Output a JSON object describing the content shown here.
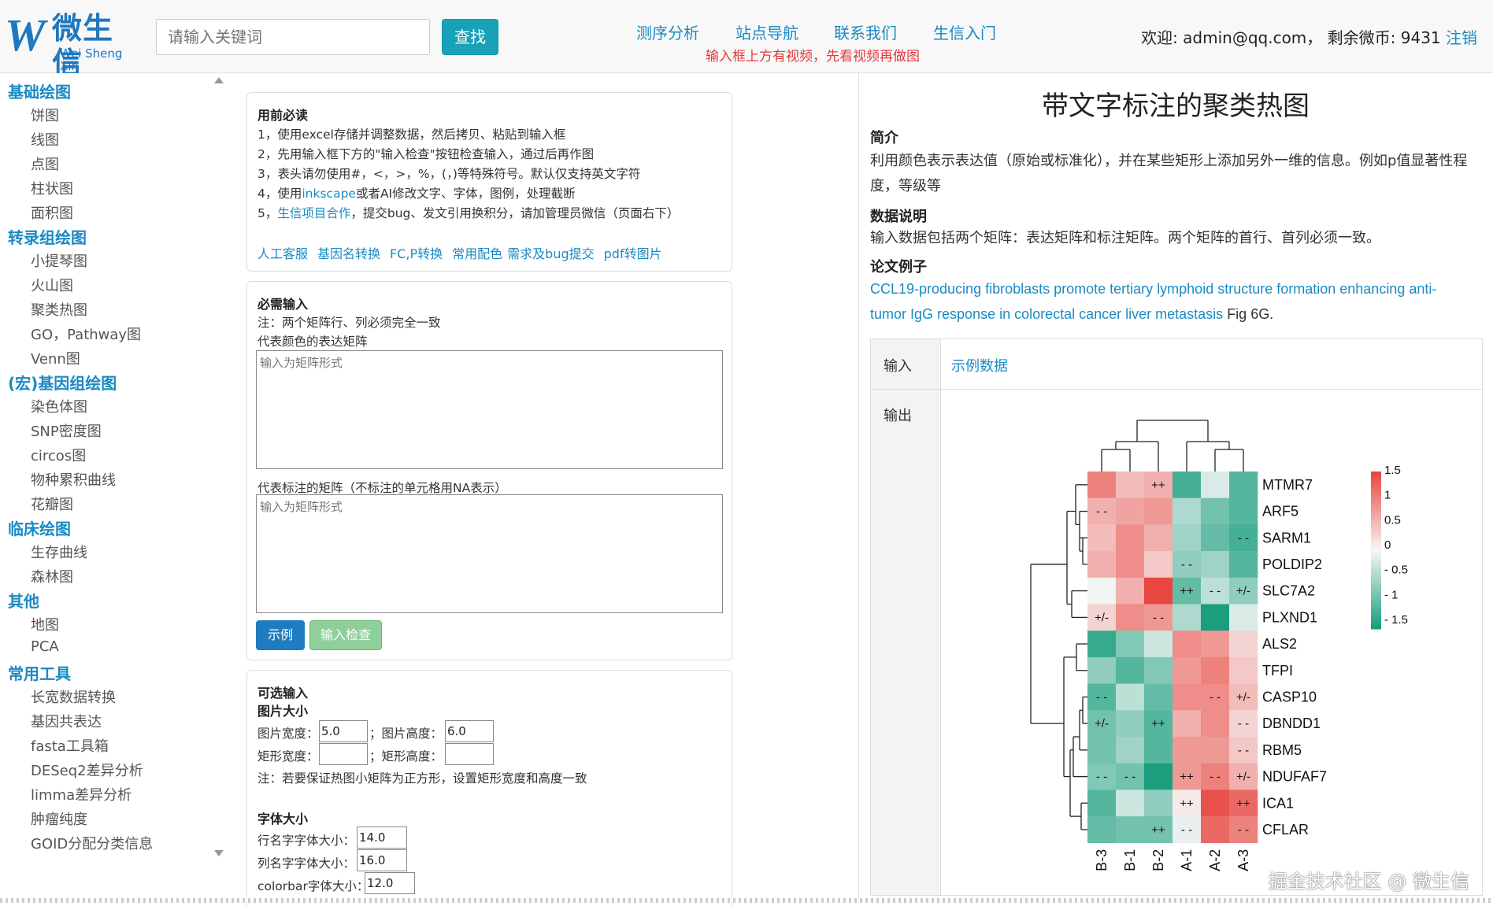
{
  "header": {
    "logo_cn": "微生信",
    "logo_py": "Wei Sheng Xin",
    "search_placeholder": "请输入关键词",
    "search_button": "查找",
    "nav": [
      "测序分析",
      "站点导航",
      "联系我们",
      "生信入门"
    ],
    "notice": "输入框上方有视频，先看视频再做图",
    "welcome": "欢迎: admin@qq.com， 剩余微币: 9431",
    "logout": "注销"
  },
  "sidebar": {
    "cat1": "基础绘图",
    "items1": [
      "饼图",
      "线图",
      "点图",
      "柱状图",
      "面积图"
    ],
    "cat2": "转录组绘图",
    "items2": [
      "小提琴图",
      "火山图",
      "聚类热图",
      "GO，Pathway图",
      "Venn图"
    ],
    "cat3": "(宏)基因组绘图",
    "items3": [
      "染色体图",
      "SNP密度图",
      "circos图",
      "物种累积曲线",
      "花瓣图"
    ],
    "cat4": "临床绘图",
    "items4": [
      "生存曲线",
      "森林图"
    ],
    "cat5": "其他",
    "items5": [
      "地图",
      "PCA"
    ],
    "cat6": "常用工具",
    "items6": [
      "长宽数据转换",
      "基因共表达",
      "fasta工具箱",
      "DESeq2差异分析",
      "limma差异分析",
      "肿瘤纯度",
      "GOID分配分类信息"
    ]
  },
  "readme": {
    "title": "用前必读",
    "l1": "1，使用excel存储并调整数据，然后拷贝、粘贴到输入框",
    "l2": "2，先用输入框下方的\"输入检查\"按钮检查输入，通过后再作图",
    "l3": "3，表头请勿使用#，<，>，%，(，)等特殊符号。默认仅支持英文字符",
    "l4a": "4，使用",
    "l4link": "inkscape",
    "l4b": "或者AI修改文字、字体，图例，处理截断",
    "l5a": "5，",
    "l5link": "生信项目合作",
    "l5b": "，提交bug、发文引用换积分，请加管理员微信（页面右下）",
    "links": [
      "人工客服",
      "基因名转换",
      "FC,P转换",
      "常用配色",
      "需求及bug提交",
      "pdf转图片"
    ]
  },
  "required": {
    "title": "必需输入",
    "note": "注：两个矩阵行、列必须完全一致",
    "label1": "代表颜色的表达矩阵",
    "placeholder1": "输入为矩阵形式",
    "label2": "代表标注的矩阵（不标注的单元格用NA表示）",
    "placeholder2": "输入为矩阵形式",
    "btn_example": "示例",
    "btn_check": "输入检查"
  },
  "optional": {
    "title": "可选输入",
    "size_title": "图片大小",
    "img_width_label": "图片宽度：",
    "img_width": "5.0",
    "img_height_label": "；图片高度：",
    "img_height": "6.0",
    "rect_width_label": "矩形宽度：",
    "rect_height_label": "；矩形高度：",
    "size_note": "注：若要保证热图小矩阵为正方形，设置矩形宽度和高度一致",
    "font_title": "字体大小",
    "row_font_label": "行名字字体大小：",
    "row_font": "14.0",
    "col_font_label": "列名字字体大小：",
    "col_font": "16.0",
    "cb_font_label": "colorbar字体大小：",
    "cb_font": "12.0"
  },
  "right": {
    "title": "带文字标注的聚类热图",
    "intro_h": "简介",
    "intro": "利用颜色表示表达值（原始或标准化），并在某些矩形上添加另外一维的信息。例如p值显著性程度，等级等",
    "data_h": "数据说明",
    "data": "输入数据包括两个矩阵：表达矩阵和标注矩阵。两个矩阵的首行、首列必须一致。",
    "paper_h": "论文例子",
    "paper_link": "CCL19-producing fibroblasts promote tertiary lymphoid structure formation enhancing anti-tumor IgG response in colorectal cancer liver metastasis",
    "paper_tail": " Fig 6G.",
    "input_label": "输入",
    "example_data": "示例数据",
    "output_label": "输出"
  },
  "heatmap": {
    "rows": [
      "MTMR7",
      "ARF5",
      "SARM1",
      "POLDIP2",
      "SLC7A2",
      "PLXND1",
      "ALS2",
      "TFPI",
      "CASP10",
      "DBNDD1",
      "RBM5",
      "NDUFAF7",
      "ICA1",
      "CFLAR"
    ],
    "cols": [
      "B-3",
      "B-1",
      "B-2",
      "A-1",
      "A-2",
      "A-3"
    ],
    "values": [
      [
        1.0,
        0.5,
        0.6,
        -1.2,
        -0.2,
        -1.1
      ],
      [
        0.6,
        0.7,
        0.8,
        -0.5,
        -0.9,
        -1.1
      ],
      [
        0.5,
        0.9,
        0.6,
        -0.6,
        -1.0,
        -1.2
      ],
      [
        0.6,
        0.9,
        0.4,
        -0.7,
        -0.6,
        -1.1
      ],
      [
        -0.05,
        0.6,
        1.5,
        -1.0,
        -0.4,
        -0.7
      ],
      [
        0.3,
        0.9,
        0.8,
        -0.5,
        -1.6,
        -0.2
      ],
      [
        -1.3,
        -0.8,
        -0.3,
        0.9,
        0.8,
        0.3
      ],
      [
        -0.7,
        -1.1,
        -0.8,
        0.8,
        1.0,
        0.4
      ],
      [
        -1.1,
        -0.4,
        -1.0,
        0.9,
        0.9,
        0.5
      ],
      [
        -0.9,
        -0.7,
        -1.1,
        0.6,
        0.9,
        0.3
      ],
      [
        -0.9,
        -0.6,
        -1.1,
        0.8,
        0.8,
        0.4
      ],
      [
        -0.8,
        -0.9,
        -1.5,
        0.8,
        1.0,
        0.6
      ],
      [
        -1.1,
        -0.3,
        -0.7,
        0.1,
        1.4,
        1.2
      ],
      [
        -1.0,
        -0.9,
        -0.9,
        -0.1,
        1.2,
        1.0
      ]
    ],
    "annotations": [
      [
        "",
        "",
        "++",
        "",
        "",
        ""
      ],
      [
        "- -",
        "",
        "",
        "",
        "",
        ""
      ],
      [
        "",
        "",
        "",
        "",
        "",
        "- -"
      ],
      [
        "",
        "",
        "",
        "- -",
        "",
        ""
      ],
      [
        "",
        "",
        "",
        "++",
        "- -",
        "+/-"
      ],
      [
        "+/-",
        "",
        "- -",
        "",
        "",
        ""
      ],
      [
        "",
        "",
        "",
        "",
        "",
        ""
      ],
      [
        "",
        "",
        "",
        "",
        "",
        ""
      ],
      [
        "- -",
        "",
        "",
        "",
        "- -",
        "+/-"
      ],
      [
        "+/-",
        "",
        "++",
        "",
        "",
        "- -"
      ],
      [
        "",
        "",
        "",
        "",
        "",
        "- -"
      ],
      [
        "- -",
        "- -",
        "",
        "++",
        "- -",
        "+/-"
      ],
      [
        "",
        "",
        "",
        "++",
        "",
        "++"
      ],
      [
        "",
        "",
        "++",
        "- -",
        "",
        "- -"
      ]
    ],
    "legend_ticks": [
      "1.5",
      "1",
      "0.5",
      "0",
      "- 0.5",
      "- 1",
      "- 1.5"
    ],
    "color_high": "#e8463f",
    "color_mid": "#f7f7f7",
    "color_low": "#1a9e7d"
  },
  "watermark": "掘金技术社区 @ 微生信"
}
